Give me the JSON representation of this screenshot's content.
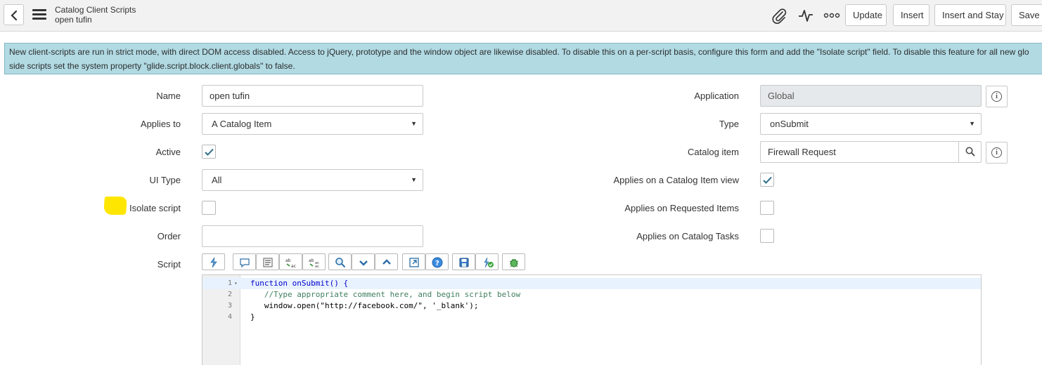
{
  "header": {
    "title": "Catalog Client Scripts",
    "subtitle": "open tufin",
    "buttons": {
      "update": "Update",
      "insert": "Insert",
      "insert_and_stay": "Insert and Stay",
      "save": "Save"
    },
    "icons": [
      "back-icon",
      "menu-icon",
      "attachment-icon",
      "activity-icon",
      "more-options-icon"
    ]
  },
  "banner": {
    "line1": "New client-scripts are run in strict mode, with direct DOM access disabled. Access to jQuery, prototype and the window object are likewise disabled. To disable this on a per-script basis, configure this form and add the \"Isolate script\" field. To disable this feature for all new glo",
    "line2": "side scripts set the system property \"glide.script.block.client.globals\" to false."
  },
  "form": {
    "name": {
      "label": "Name",
      "value": "open tufin"
    },
    "applies_to": {
      "label": "Applies to",
      "value": "A Catalog Item"
    },
    "active": {
      "label": "Active",
      "checked": true
    },
    "ui_type": {
      "label": "UI Type",
      "value": "All"
    },
    "isolate_script": {
      "label": "Isolate script",
      "checked": false
    },
    "order": {
      "label": "Order",
      "value": ""
    },
    "script": {
      "label": "Script"
    },
    "application": {
      "label": "Application",
      "value": "Global"
    },
    "type": {
      "label": "Type",
      "value": "onSubmit"
    },
    "catalog_item": {
      "label": "Catalog item",
      "value": "Firewall Request"
    },
    "applies_on_catalog_item_view": {
      "label": "Applies on a Catalog Item view",
      "checked": true
    },
    "applies_on_requested_items": {
      "label": "Applies on Requested Items",
      "checked": false
    },
    "applies_on_catalog_tasks": {
      "label": "Applies on Catalog Tasks",
      "checked": false
    }
  },
  "script_toolbar": {
    "icons": [
      "format-code-icon",
      "comment-icon",
      "block-comment-icon",
      "replace-icon",
      "replace-all-icon",
      "search-icon",
      "next-icon",
      "previous-icon",
      "fullscreen-icon",
      "help-icon",
      "save-icon",
      "syntax-check-icon",
      "debug-icon"
    ]
  },
  "editor": {
    "lines": [
      {
        "num": "1",
        "fold": "▾",
        "text": "function onSubmit() {"
      },
      {
        "num": "2",
        "fold": "",
        "text": "   //Type appropriate comment here, and begin script below"
      },
      {
        "num": "3",
        "fold": "",
        "text": "   window.open(\"http://facebook.com/\", '_blank');"
      },
      {
        "num": "4",
        "fold": "",
        "text": "}"
      }
    ]
  },
  "colors": {
    "banner_bg": "#b1dae3",
    "header_bg": "#f2f2f2",
    "check_color": "#2a6b8a",
    "highlight": "#ffe600"
  }
}
